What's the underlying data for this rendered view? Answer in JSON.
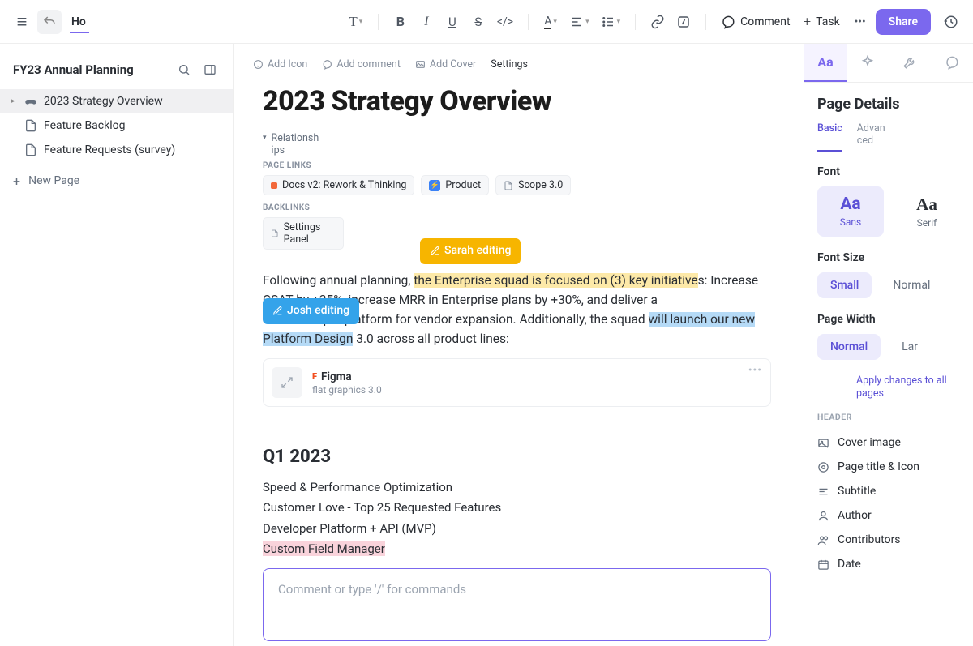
{
  "toolbar": {
    "home_label": "Ho",
    "comment_label": "Comment",
    "task_label": "Task",
    "share_label": "Share"
  },
  "sidebar": {
    "title": "FY23 Annual Planning",
    "items": [
      {
        "label": "2023 Strategy Overview",
        "icon": "gamepad",
        "active": true
      },
      {
        "label": "Feature Backlog",
        "icon": "page",
        "active": false
      },
      {
        "label": "Feature Requests (survey)",
        "icon": "page",
        "active": false
      }
    ],
    "new_page_label": "New Page"
  },
  "page_actions": {
    "add_icon": "Add Icon",
    "add_comment": "Add comment",
    "add_cover": "Add Cover",
    "settings": "Settings"
  },
  "page": {
    "title": "2023 Strategy Overview",
    "relationships_label": "Relationships",
    "page_links_label": "PAGE LINKS",
    "page_links": [
      {
        "label": "Docs v2: Rework & Thinking",
        "color": "#f2683b",
        "type": "dot"
      },
      {
        "label": "Product",
        "color": "#3b82f6",
        "type": "icon"
      },
      {
        "label": "Scope 3.0",
        "type": "page"
      }
    ],
    "backlinks_label": "BACKLINKS",
    "backlinks": [
      {
        "label": "Settings Panel",
        "type": "page"
      }
    ],
    "editors": {
      "sarah": "Sarah editing",
      "josh": "Josh editing"
    },
    "body": {
      "pre1": "Following annual planning, ",
      "hl1": "the Enterprise squad is focused on (3) key initiative",
      "post1": "s: Increase CSAT by +25%, increase MRR in Enterprise plans by +30%, and deliver a ",
      "gap1": "                                             ",
      "mid1": " and developer platform for vendor expansion. Additionally, the squad ",
      "hl2": "will launch our new Platform Design",
      "post2": " 3.0 across all product lines:"
    },
    "embed": {
      "title": "Figma",
      "subtitle": "flat graphics 3.0"
    },
    "q1": {
      "heading": "Q1 2023",
      "lines": [
        "Speed & Performance Optimization",
        "Customer Love - Top 25 Requested Features",
        "Developer Platform + API (MVP)"
      ],
      "highlighted": "Custom Field Manager"
    },
    "comment_placeholder": "Comment or type '/' for commands"
  },
  "rpanel": {
    "title": "Page Details",
    "tabs": {
      "basic": "Basic",
      "advanced": "Advanced"
    },
    "font_label": "Font",
    "font_opts": {
      "sans": "Sans",
      "serif": "Serif",
      "sample": "Aa"
    },
    "fontsize_label": "Font Size",
    "fontsize_opts": {
      "small": "Small",
      "normal": "Normal"
    },
    "width_label": "Page Width",
    "width_opts": {
      "normal": "Normal",
      "large": "Lar"
    },
    "apply_label": "Apply changes to all pages",
    "header_label": "HEADER",
    "header_items": [
      "Cover image",
      "Page title & Icon",
      "Subtitle",
      "Author",
      "Contributors",
      "Date"
    ]
  }
}
